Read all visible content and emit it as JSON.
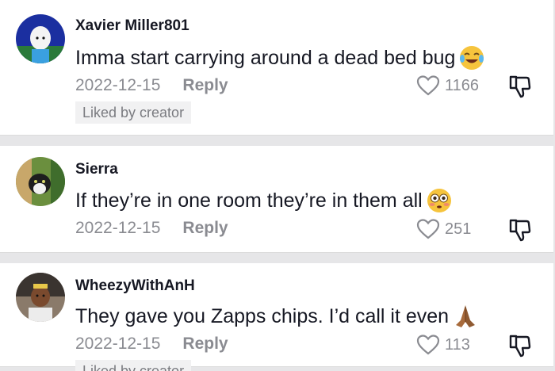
{
  "comments": [
    {
      "username": "Xavier Miller801",
      "text": "Imma start carrying around a dead bed bug",
      "emoji": "face-with-tears-of-joy",
      "date": "2022-12-15",
      "reply_label": "Reply",
      "likes": "1166",
      "badge": "Liked by creator"
    },
    {
      "username": "Sierra",
      "text": "If they’re in one room they’re in them all",
      "emoji": "flushed-face",
      "date": "2022-12-15",
      "reply_label": "Reply",
      "likes": "251"
    },
    {
      "username": "WheezyWithAnH",
      "text": "They gave you Zapps chips. I’d call it even",
      "emoji": "folded-hands",
      "date": "2022-12-15",
      "reply_label": "Reply",
      "likes": "113",
      "badge": "Liked by creator"
    }
  ]
}
